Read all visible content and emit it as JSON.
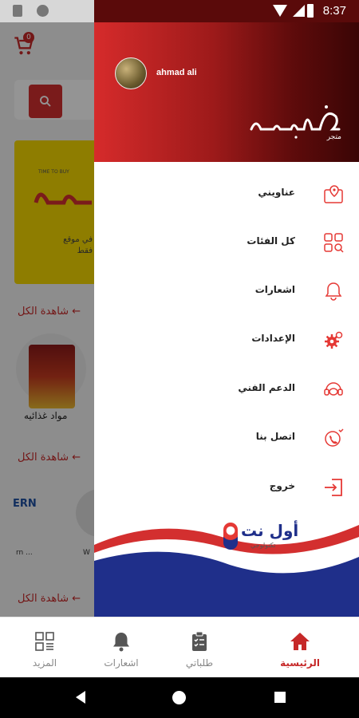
{
  "status_bar": {
    "time": "8:37"
  },
  "background": {
    "cart_badge": "0",
    "banner_tag": "TIME TO BUY",
    "banner_text": "في موقع\nفقط",
    "see_all": "شاهدة الكل ←",
    "category_label": "مواد غذائيه",
    "brand_ern": "ERN",
    "small_labels": [
      "rn ...",
      "W"
    ]
  },
  "drawer": {
    "username": "ahmad ali",
    "brand_sub": "متجر",
    "menu": [
      {
        "label": "عناويني",
        "icon": "map-pin-icon"
      },
      {
        "label": "كل الفئات",
        "icon": "categories-grid-icon"
      },
      {
        "label": "اشعارات",
        "icon": "bell-icon"
      },
      {
        "label": "الإعدادات",
        "icon": "gear-icon"
      },
      {
        "label": "الدعم الفني",
        "icon": "support-headset-icon"
      },
      {
        "label": "اتصل بنا",
        "icon": "contact-phone-icon"
      },
      {
        "label": "خروج",
        "icon": "logout-icon"
      }
    ],
    "partner_logo_text": "أول نت",
    "partner_logo_sub": "تكنولوجي"
  },
  "bottom_nav": [
    {
      "label": "المزيد",
      "icon": "more-grid-icon",
      "active": false
    },
    {
      "label": "اشعارات",
      "icon": "bell-icon",
      "active": false
    },
    {
      "label": "طلباتي",
      "icon": "clipboard-icon",
      "active": false
    },
    {
      "label": "الرئيسية",
      "icon": "home-icon",
      "active": true
    }
  ],
  "colors": {
    "accent": "#c62828",
    "header_dark": "#3a0505",
    "wave_blue": "#1f2f8a"
  }
}
